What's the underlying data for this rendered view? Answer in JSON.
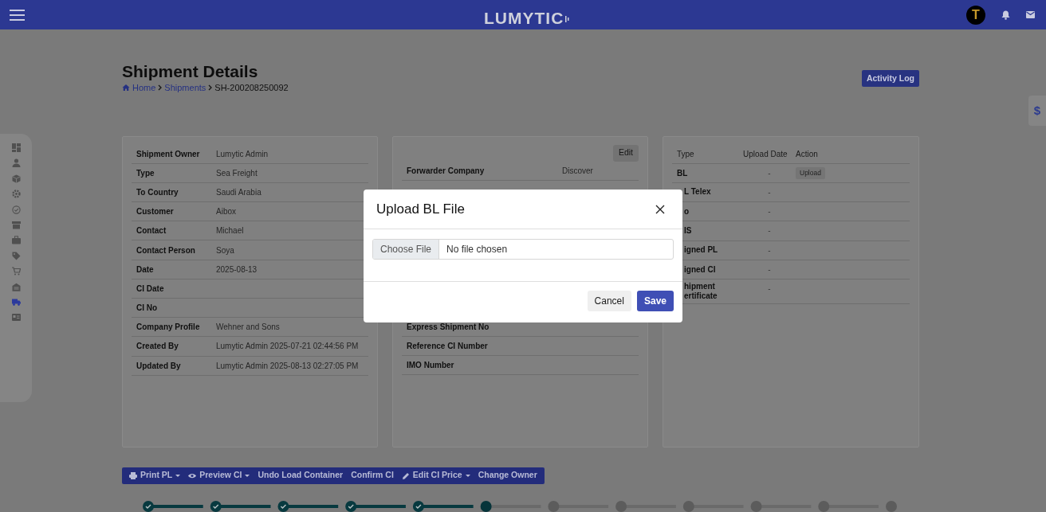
{
  "header": {
    "logo": "LUMYTIC",
    "avatar": "T"
  },
  "sidebar": {
    "items": [
      {
        "selected": false
      },
      {
        "selected": false
      },
      {
        "selected": false
      },
      {
        "selected": false
      },
      {
        "selected": false
      },
      {
        "selected": false
      },
      {
        "selected": false
      },
      {
        "selected": false
      },
      {
        "selected": false
      },
      {
        "selected": false
      },
      {
        "selected": true
      },
      {
        "selected": false
      }
    ]
  },
  "side_tab": "$",
  "page": {
    "title": "Shipment Details",
    "breadcrumb": [
      "Home",
      "Shipments",
      "SH-200208250092"
    ],
    "activity_button": "Activity Log"
  },
  "details": [
    {
      "label": "Shipment Owner",
      "value": "Lumytic Admin"
    },
    {
      "label": "Type",
      "value": "Sea Freight"
    },
    {
      "label": "To Country",
      "value": "Saudi Arabia"
    },
    {
      "label": "Customer",
      "value": "Aibox"
    },
    {
      "label": "Contact",
      "value": "Michael"
    },
    {
      "label": "Contact Person",
      "value": "Soya"
    },
    {
      "label": "Date",
      "value": "2025-08-13"
    },
    {
      "label": "CI Date"
    },
    {
      "label": "CI No"
    },
    {
      "label": "Company Profile",
      "value": "Wehner and Sons"
    },
    {
      "label": "Created By",
      "value": "Lumytic Admin 2025-07-21 02:44:56 PM"
    },
    {
      "label": "Updated By",
      "value": "Lumytic Admin 2025-08-13 02:27:05 PM"
    }
  ],
  "forwarder": {
    "edit_button": "Edit",
    "top_rows": [
      {
        "label": "Forwarder Company",
        "value": "Discover"
      }
    ],
    "bottom_rows": [
      {
        "label": "Express Shipment No"
      },
      {
        "label": "Reference CI Number"
      },
      {
        "label": "IMO Number"
      }
    ]
  },
  "documents": {
    "columns": [
      "Type",
      "Upload Date",
      "Action"
    ],
    "rows": [
      {
        "type": "BL",
        "date": "-",
        "action": "Upload",
        "clipped": false
      },
      {
        "type": "L Telex",
        "date": "-",
        "clipped": true
      },
      {
        "type": "o",
        "date": "-",
        "clipped": true
      },
      {
        "type": "IS",
        "date": "-",
        "clipped": true
      },
      {
        "type": "igned PL",
        "date": "-",
        "clipped": true
      },
      {
        "type": "igned CI",
        "date": "-",
        "clipped": true
      },
      {
        "type": "hipment ertificate",
        "date": "-",
        "clipped": true
      }
    ]
  },
  "toolbar": [
    {
      "label": "Print PL",
      "kind": "print",
      "has_menu": true
    },
    {
      "label": "Preview CI",
      "kind": "view",
      "has_menu": true
    },
    {
      "label": "Undo Load Container",
      "kind": "plain",
      "has_menu": false
    },
    {
      "label": "Confirm CI",
      "kind": "plain",
      "has_menu": false
    },
    {
      "label": "Edit CI Price",
      "kind": "edit",
      "has_menu": true
    },
    {
      "label": "Change Owner",
      "kind": "plain",
      "has_menu": false
    }
  ],
  "stepper": [
    {
      "completed": true,
      "current": false
    },
    {
      "completed": true,
      "current": false
    },
    {
      "completed": true,
      "current": false
    },
    {
      "completed": true,
      "current": false
    },
    {
      "completed": true,
      "current": false
    },
    {
      "completed": false,
      "current": true
    },
    {
      "completed": false,
      "current": false
    },
    {
      "completed": false,
      "current": false
    },
    {
      "completed": false,
      "current": false
    },
    {
      "completed": false,
      "current": false
    },
    {
      "completed": false,
      "current": false
    },
    {
      "completed": false,
      "current": false
    }
  ],
  "modal": {
    "title": "Upload BL File",
    "file_button": "Choose File",
    "file_status": "No file chosen",
    "cancel": "Cancel",
    "save": "Save"
  }
}
